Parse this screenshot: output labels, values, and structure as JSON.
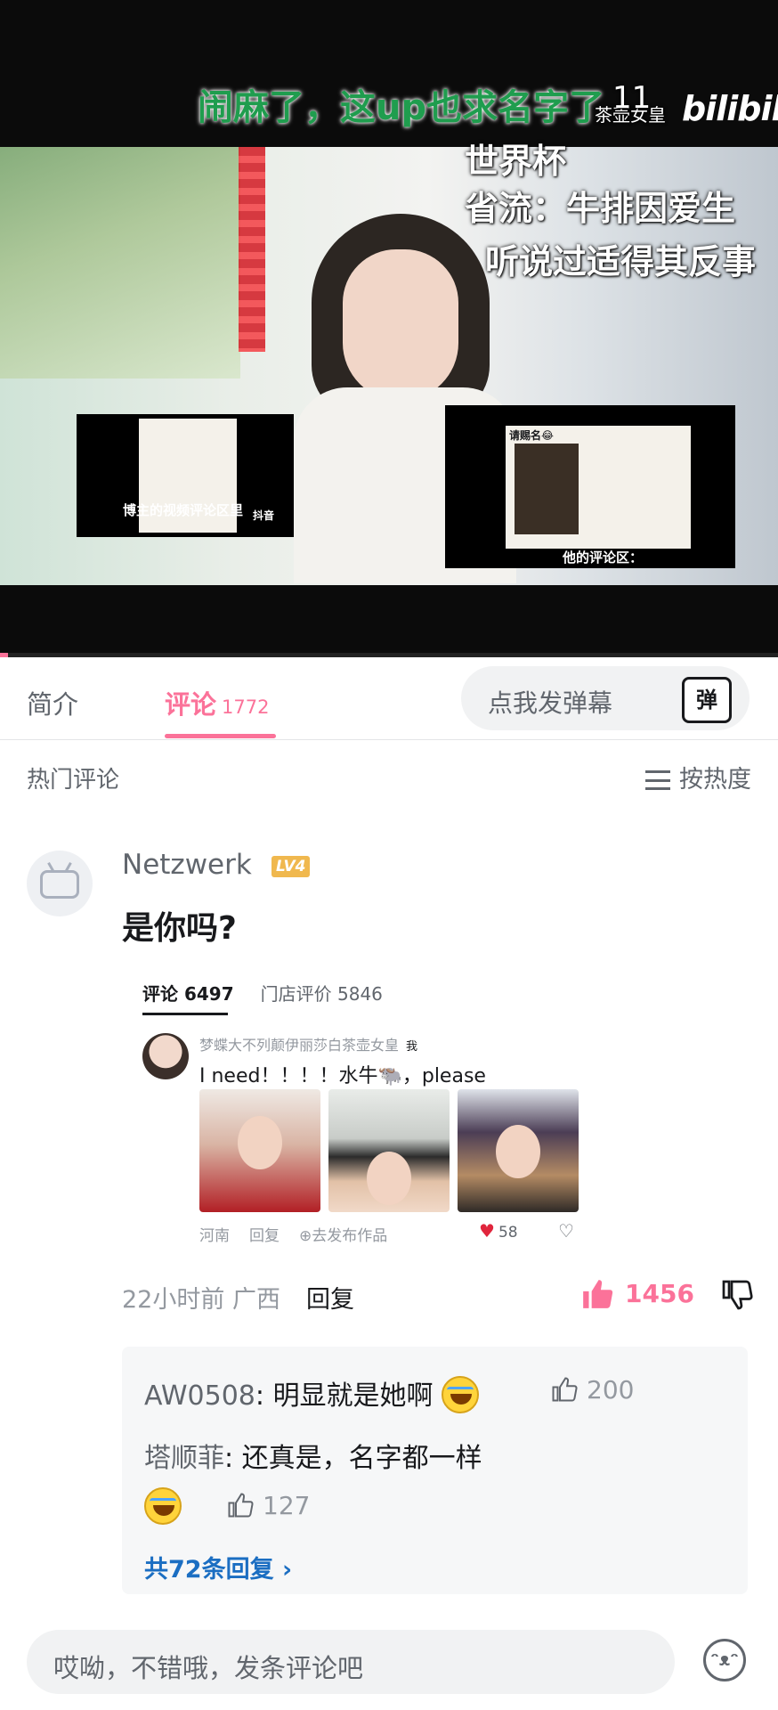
{
  "video": {
    "overlay_top": "闹麻了，这up也求名字了",
    "overlay_top_right": "茶壶女皇",
    "overlay_number": "11",
    "brand": "bilibili",
    "overlay_lines": [
      "世界杯",
      "省流：牛排因爱生",
      "听说过适得其反事"
    ],
    "inset_left_caption": "博主的视频评论区里",
    "inset_left_brand": "抖音",
    "inset_right_title": "请赐名😂",
    "inset_right_caption": "他的评论区：",
    "progress_fraction": 0.01
  },
  "tabs": {
    "intro": "简介",
    "comments": "评论",
    "comments_count": "1772",
    "danmaku_prompt": "点我发弹幕",
    "danmaku_icon": "弹"
  },
  "section": {
    "hot_comments": "热门评论",
    "sort": "按热度"
  },
  "comment": {
    "username": "Netzwerk",
    "level": "LV4",
    "text": "是你吗?",
    "time_location": "22小时前 广西",
    "reply_label": "回复",
    "likes": "1456"
  },
  "embedded": {
    "tab_comments": "评论 6497",
    "tab_reviews": "门店评价 5846",
    "user": "梦蝶大不列颠伊丽莎白茶壶女皇",
    "me_tag": "我",
    "message": "I need！！！！水牛🐃，please",
    "meta_location": "河南",
    "meta_reply": "回复",
    "meta_publish": "⊕去发布作品",
    "likes": "58"
  },
  "replies": [
    {
      "name": "AW0508",
      "text": "明显就是她啊",
      "likes": "200"
    },
    {
      "name": "塔顺菲",
      "text": "还真是，名字都一样",
      "likes": "127"
    }
  ],
  "replies_more": "共72条回复 ›",
  "input": {
    "placeholder": "哎呦，不错哦，发条评论吧"
  },
  "colors": {
    "accent": "#fb7299",
    "link": "#1b6ec2"
  }
}
